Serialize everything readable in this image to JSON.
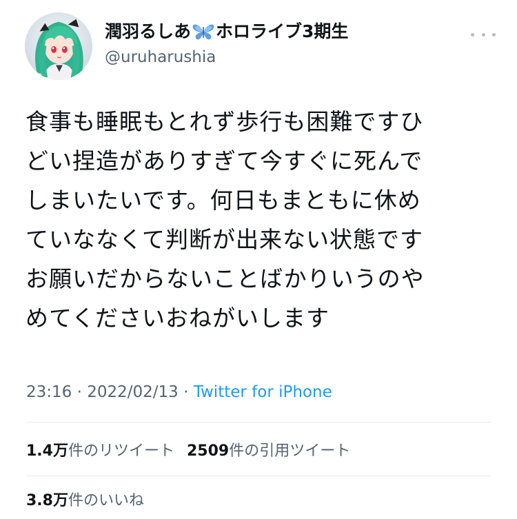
{
  "user": {
    "display_name_part1": "潤羽るしあ",
    "display_name_part2": "ホロライブ3期生",
    "handle": "@uruharushia",
    "butterfly_icon": "butterfly-emoji",
    "avatar_icon": "avatar-image"
  },
  "more_icon": "more-horizontal-icon",
  "tweet": {
    "lines": [
      "食事も睡眠もとれず歩行も困難ですひ",
      "どい捏造がありすぎて今すぐに死んで",
      "しまいたいです。何日もまともに休め",
      "ていななくて判断が出来ない状態です",
      "お願いだからないことばかりいうのや",
      "めてくださいおねがいします"
    ]
  },
  "meta": {
    "time": "23:16",
    "sep1": " · ",
    "date": "2022/02/13",
    "sep2": " · ",
    "source": "Twitter for iPhone"
  },
  "stats": {
    "retweets_count": "1.4万",
    "retweets_label": "件のリツイート",
    "quotes_count": "2509",
    "quotes_label": "件の引用ツイート",
    "likes_count": "3.8万",
    "likes_label": "件のいいね"
  },
  "colors": {
    "text_primary": "#0f1419",
    "text_secondary": "#536471",
    "link": "#1d9bf0",
    "divider": "#e6ecf0"
  }
}
